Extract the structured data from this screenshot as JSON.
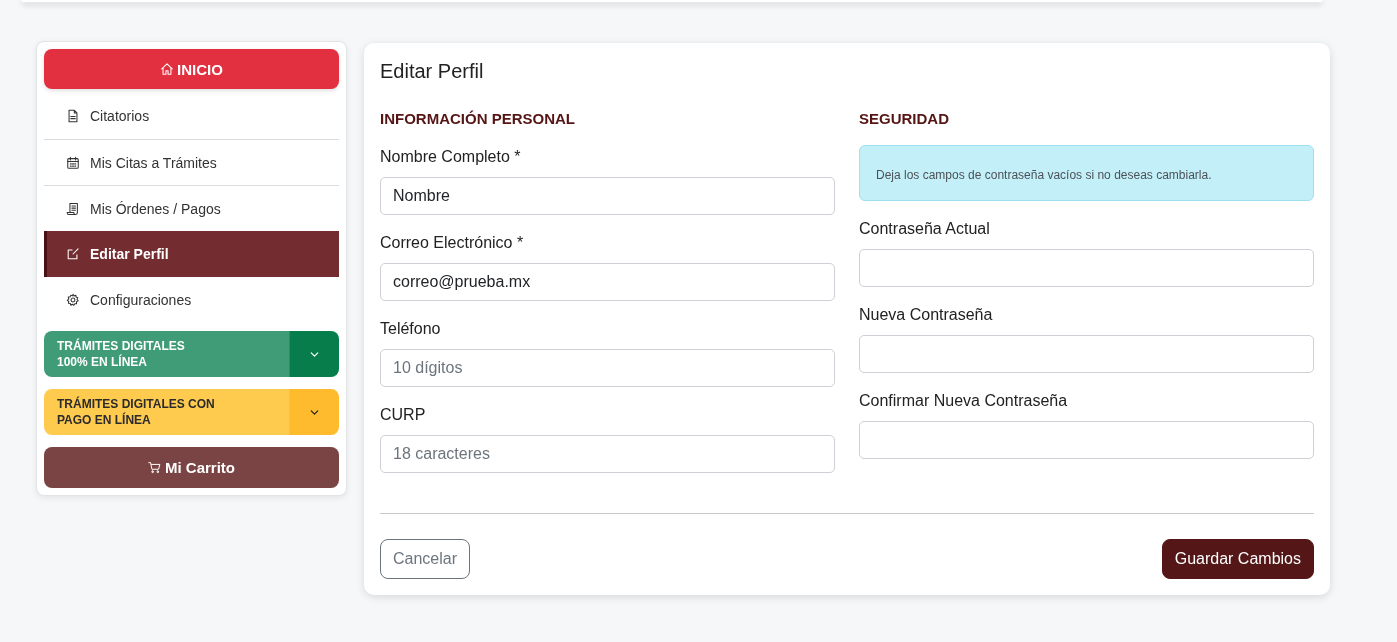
{
  "sidebar": {
    "home_button": {
      "label": "INICIO"
    },
    "items": [
      {
        "label": "Citatorios",
        "selected": false
      },
      {
        "label": "Mis Citas a Trámites",
        "selected": false
      },
      {
        "label": "Mis Órdenes / Pagos",
        "selected": false
      },
      {
        "label": "Editar Perfil",
        "selected": true
      },
      {
        "label": "Configuraciones",
        "selected": false
      }
    ],
    "accordions": [
      {
        "label": "TRÁMITES DIGITALES\n100% EN LÍNEA",
        "kind": "success",
        "expanded": false
      },
      {
        "label": "TRÁMITES DIGITALES CON\nPAGO EN LÍNEA",
        "kind": "warning",
        "expanded": false
      }
    ],
    "cart_button": {
      "label": "Mi Carrito"
    }
  },
  "form": {
    "title": "Editar Perfil",
    "sections": [
      {
        "heading": "INFORMACIÓN PERSONAL",
        "fields": [
          {
            "label": "Nombre Completo *",
            "value": "Nombre"
          },
          {
            "label": "Correo Electrónico *",
            "value": "correo@prueba.mx"
          },
          {
            "label": "Teléfono",
            "placeholder": "10 dígitos"
          },
          {
            "label": "CURP",
            "placeholder": "18 caracteres"
          }
        ]
      },
      {
        "heading": "SEGURIDAD",
        "alert": "Deja los campos de contraseña vacíos si no deseas cambiarla.",
        "fields": [
          {
            "label": "Contraseña Actual"
          },
          {
            "label": "Nueva Contraseña"
          },
          {
            "label": "Confirmar Nueva Contraseña"
          }
        ]
      }
    ],
    "buttons": [
      {
        "label": "Cancelar",
        "kind": "outline"
      },
      {
        "label": "Guardar Cambios",
        "kind": "primary"
      }
    ]
  }
}
